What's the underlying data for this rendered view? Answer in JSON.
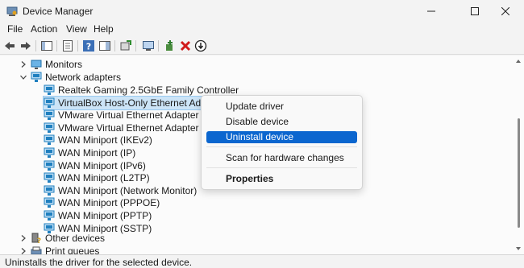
{
  "window": {
    "title": "Device Manager"
  },
  "menu": [
    "File",
    "Action",
    "View",
    "Help"
  ],
  "tree": {
    "partial_top": "Monitors",
    "network_adapters": "Network adapters",
    "adapters": [
      "Realtek Gaming 2.5GbE Family Controller",
      "VirtualBox Host-Only Ethernet Adapter",
      "VMware Virtual Ethernet Adapter for VM",
      "VMware Virtual Ethernet Adapter for VM",
      "WAN Miniport (IKEv2)",
      "WAN Miniport (IP)",
      "WAN Miniport (IPv6)",
      "WAN Miniport (L2TP)",
      "WAN Miniport (Network Monitor)",
      "WAN Miniport (PPPOE)",
      "WAN Miniport (PPTP)",
      "WAN Miniport (SSTP)"
    ],
    "other_devices": "Other devices",
    "partial_bottom": "Print queues"
  },
  "context_menu": {
    "update": "Update driver",
    "disable": "Disable device",
    "uninstall": "Uninstall device",
    "scan": "Scan for hardware changes",
    "properties": "Properties"
  },
  "status": "Uninstalls the driver for the selected device.",
  "colors": {
    "highlight": "#0b66cf",
    "selection_row": "#cce4f7",
    "error_red": "#d11b1b",
    "network_icon": "#1f7fbf"
  }
}
